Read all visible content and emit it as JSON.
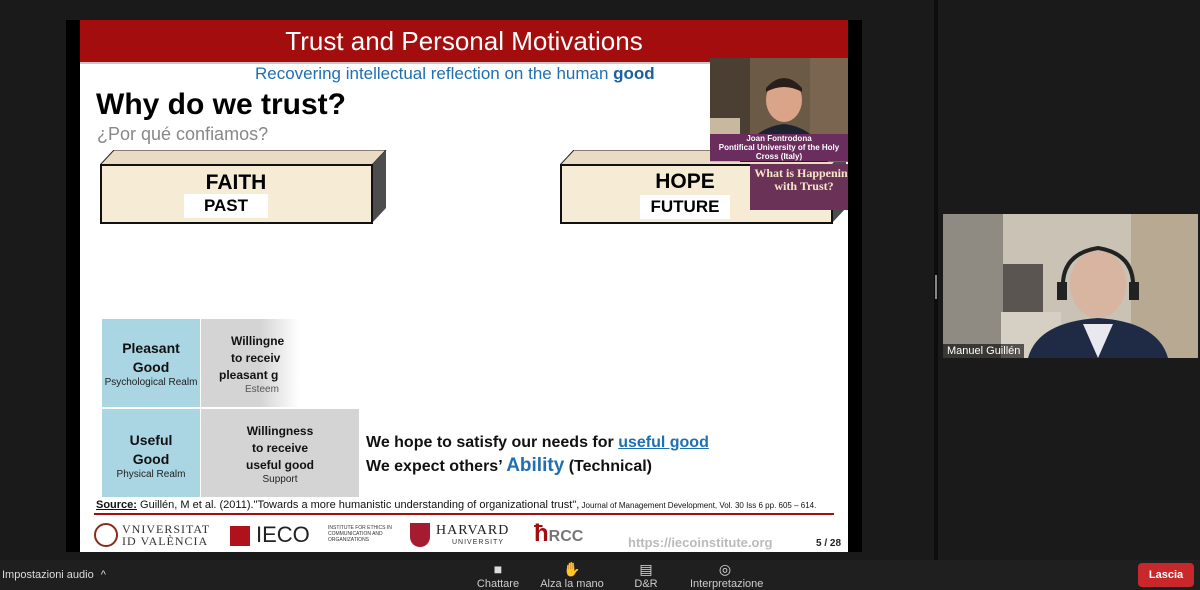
{
  "slide": {
    "title": "Trust and Personal Motivations",
    "subtitle_prefix": "Recovering intellectual reflection on the human ",
    "subtitle_bold": "good",
    "heading": "Why do we trust?",
    "subheading": "¿Por qué confiamos?",
    "faith": {
      "word": "FAITH",
      "tag": "PAST"
    },
    "hope": {
      "word": "HOPE",
      "tag": "FUTURE"
    },
    "matrix": {
      "pleasant": {
        "line1": "Pleasant",
        "line2": "Good",
        "realm": "Psychological Realm"
      },
      "pleasant_will": {
        "line1": "Willingne",
        "line2": "to receiv",
        "line3": "pleasant g",
        "sub": "Esteem"
      },
      "useful": {
        "line1": "Useful",
        "line2": "Good",
        "realm": "Physical Realm"
      },
      "useful_will": {
        "line1": "Willingness",
        "line2": "to receive",
        "line3": "useful good",
        "sub": "Support"
      }
    },
    "hope_text": {
      "line1_prefix": "We hope to satisfy our needs for ",
      "line1_link": "useful good",
      "line2_prefix": "We expect others’ ",
      "line2_big": "Ability",
      "line2_suffix": " (Technical)"
    },
    "source": {
      "label": "Source:",
      "text": " Guillén, M et al. (2011).\"Towards a more humanistic understanding of organizational trust\",",
      "journal": " Journal of Management Development, Vol. 30 Iss 6 pp. 605 – 614."
    },
    "logos": {
      "uv_line1": "VNIVERSITAT",
      "uv_line2": "ID VALÈNCIA",
      "ieco": "IECO",
      "ieco_sub": "INSTITUTE FOR ETHICS IN COMMUNICATION AND ORGANIZATIONS",
      "harvard": "HARVARD",
      "harvard_sub": "UNIVERSITY",
      "rcc": "ħ",
      "rcc_small": "RCC"
    },
    "url": "https://iecoinstitute.org",
    "page": "5 / 28",
    "what_box": "What is Happening with Trust?"
  },
  "pip_cam": {
    "caption_line1": "Joan Fontrodona",
    "caption_line2": "Pontifical University of the Holy",
    "caption_line3": "Cross (Italy)"
  },
  "speaker_cam": {
    "name": "Manuel Guillén"
  },
  "bottom_bar": {
    "audio": "Impostazioni audio",
    "chevron": "^",
    "chat": "Chattare",
    "raise_hand": "Alza la mano",
    "qa": "D&R",
    "interpretation": "Interpretazione",
    "leave": "Lascia"
  },
  "colors": {
    "title_bar": "#a30d0d",
    "accent_blue": "#1f6fb2",
    "leave": "#c8282b"
  }
}
